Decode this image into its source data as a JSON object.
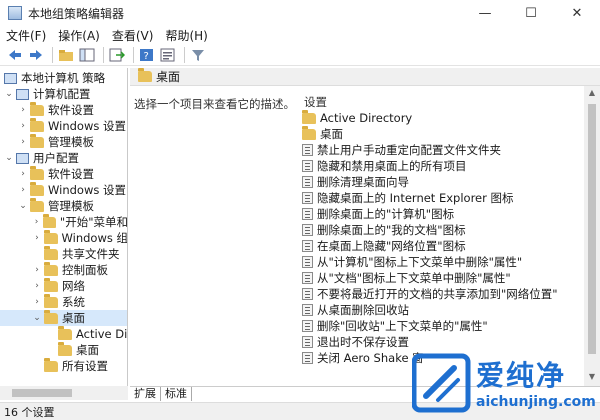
{
  "window": {
    "title": "本地组策略编辑器",
    "controls": {
      "minimize": "—",
      "maximize": "☐",
      "close": "✕"
    }
  },
  "menu": [
    "文件(F)",
    "操作(A)",
    "查看(V)",
    "帮助(H)"
  ],
  "toolbar": {
    "icons": [
      "back-icon",
      "forward-icon",
      "folder-up-icon",
      "show-tree-icon",
      "export-icon",
      "help-icon",
      "properties-icon",
      "filter-icon"
    ]
  },
  "tree": [
    {
      "label": "本地计算机 策略",
      "level": 0,
      "chev": "",
      "icon": "policy"
    },
    {
      "label": "计算机配置",
      "level": 1,
      "chev": "v",
      "icon": "computer"
    },
    {
      "label": "软件设置",
      "level": 2,
      "chev": ">",
      "icon": "folder"
    },
    {
      "label": "Windows 设置",
      "level": 2,
      "chev": ">",
      "icon": "folder"
    },
    {
      "label": "管理模板",
      "level": 2,
      "chev": ">",
      "icon": "folder"
    },
    {
      "label": "用户配置",
      "level": 1,
      "chev": "v",
      "icon": "user"
    },
    {
      "label": "软件设置",
      "level": 2,
      "chev": ">",
      "icon": "folder"
    },
    {
      "label": "Windows 设置",
      "level": 2,
      "chev": ">",
      "icon": "folder"
    },
    {
      "label": "管理模板",
      "level": 2,
      "chev": "v",
      "icon": "folder"
    },
    {
      "label": "\"开始\"菜单和",
      "level": 3,
      "chev": ">",
      "icon": "folder"
    },
    {
      "label": "Windows 组",
      "level": 3,
      "chev": ">",
      "icon": "folder"
    },
    {
      "label": "共享文件夹",
      "level": 3,
      "chev": "",
      "icon": "folder"
    },
    {
      "label": "控制面板",
      "level": 3,
      "chev": ">",
      "icon": "folder"
    },
    {
      "label": "网络",
      "level": 3,
      "chev": ">",
      "icon": "folder"
    },
    {
      "label": "系统",
      "level": 3,
      "chev": ">",
      "icon": "folder"
    },
    {
      "label": "桌面",
      "level": 3,
      "chev": "v",
      "icon": "folder",
      "selected": true
    },
    {
      "label": "Active Di",
      "level": 4,
      "chev": "",
      "icon": "folder"
    },
    {
      "label": "桌面",
      "level": 4,
      "chev": "",
      "icon": "folder"
    },
    {
      "label": "所有设置",
      "level": 3,
      "chev": "",
      "icon": "folder"
    }
  ],
  "right_pane": {
    "header": "桌面",
    "description": "选择一个项目来查看它的描述。",
    "column_header": "设置",
    "items": [
      {
        "label": "Active Directory",
        "type": "folder"
      },
      {
        "label": "桌面",
        "type": "folder"
      },
      {
        "label": "禁止用户手动重定向配置文件文件夹",
        "type": "policy"
      },
      {
        "label": "隐藏和禁用桌面上的所有项目",
        "type": "policy"
      },
      {
        "label": "删除清理桌面向导",
        "type": "policy"
      },
      {
        "label": "隐藏桌面上的 Internet Explorer 图标",
        "type": "policy"
      },
      {
        "label": "删除桌面上的\"计算机\"图标",
        "type": "policy"
      },
      {
        "label": "删除桌面上的\"我的文档\"图标",
        "type": "policy"
      },
      {
        "label": "在桌面上隐藏\"网络位置\"图标",
        "type": "policy"
      },
      {
        "label": "从\"计算机\"图标上下文菜单中删除\"属性\"",
        "type": "policy"
      },
      {
        "label": "从\"文档\"图标上下文菜单中删除\"属性\"",
        "type": "policy"
      },
      {
        "label": "不要将最近打开的文档的共享添加到\"网络位置\"",
        "type": "policy"
      },
      {
        "label": "从桌面删除回收站",
        "type": "policy"
      },
      {
        "label": "删除\"回收站\"上下文菜单的\"属性\"",
        "type": "policy"
      },
      {
        "label": "退出时不保存设置",
        "type": "policy"
      },
      {
        "label": "关闭 Aero Shake 窗",
        "type": "policy"
      }
    ]
  },
  "tabs": [
    "扩展",
    "标准"
  ],
  "status": "16 个设置",
  "watermark": {
    "text": "爱纯净",
    "url": "aichunjing.com"
  },
  "colors": {
    "selection": "#d6e8fb",
    "folder": "#e8c15a",
    "watermark_blue": "#1e6fd0"
  }
}
